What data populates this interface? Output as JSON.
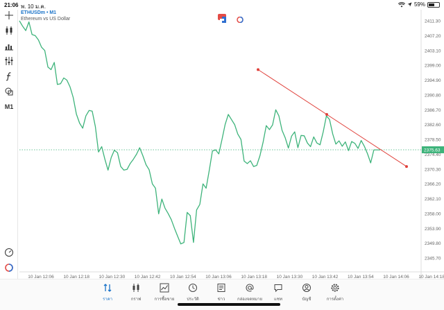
{
  "status": {
    "time": "21:06",
    "date": "พ. 10 ม.ค.",
    "battery_pct": 0.59,
    "battery_label": "59%"
  },
  "symbol": {
    "name": "ETHUSDm • M1",
    "description": "Ethereum vs US Dollar"
  },
  "toolbar": {
    "timeframe_label": "M1",
    "tools": [
      "crosshair-icon",
      "candle-icon",
      "bar-chart-icon",
      "settings-sliders-icon",
      "function-icon",
      "shapes-icon"
    ]
  },
  "chart_data": {
    "type": "line",
    "color": "#3db37a",
    "y_axis_labels": [
      "2411.30",
      "2407.20",
      "2403.10",
      "2399.00",
      "2394.90",
      "2390.80",
      "2386.70",
      "2382.60",
      "2378.50",
      "2374.40",
      "2370.30",
      "2366.20",
      "2362.10",
      "2358.00",
      "2353.90",
      "2349.80",
      "2345.70"
    ],
    "x_axis_labels": [
      "10 Jan 12:06",
      "10 Jan 12:18",
      "10 Jan 12:30",
      "10 Jan 12:42",
      "10 Jan 12:54",
      "10 Jan 13:06",
      "10 Jan 13:18",
      "10 Jan 13:30",
      "10 Jan 13:42",
      "10 Jan 13:54",
      "10 Jan 14:06",
      "10 Jan 14:18"
    ],
    "current_price_label": "2375.63",
    "current_price": 2375.63,
    "ylim": [
      2345.7,
      2411.3
    ],
    "series": [
      {
        "values": [
          2411.3,
          2409.8,
          2408.6,
          2411.0,
          2407.5,
          2407.2,
          2406.0,
          2404.0,
          2403.1,
          2398.5,
          2397.8,
          2399.8,
          2393.7,
          2393.9,
          2395.5,
          2394.9,
          2393.0,
          2390.1,
          2385.5,
          2383.0,
          2381.6,
          2385.0,
          2386.5,
          2386.3,
          2382.0,
          2375.0,
          2376.5,
          2373.0,
          2370.0,
          2373.5,
          2375.5,
          2374.8,
          2371.0,
          2370.0,
          2370.2,
          2371.8,
          2373.0,
          2374.4,
          2376.2,
          2374.0,
          2371.5,
          2370.1,
          2366.2,
          2365.0,
          2357.9,
          2362.0,
          2359.5,
          2358.0,
          2356.3,
          2353.9,
          2351.7,
          2349.6,
          2350.0,
          2358.3,
          2357.4,
          2350.0,
          2359.0,
          2360.5,
          2366.2,
          2365.0,
          2370.0,
          2375.3,
          2375.6,
          2374.5,
          2378.4,
          2382.6,
          2385.4,
          2384.0,
          2382.6,
          2380.0,
          2378.5,
          2372.5,
          2371.8,
          2372.6,
          2371.0,
          2371.3,
          2374.0,
          2377.7,
          2382.3,
          2381.2,
          2382.5,
          2386.7,
          2385.0,
          2381.0,
          2378.9,
          2376.1,
          2379.4,
          2380.6,
          2376.2,
          2379.6,
          2379.5,
          2377.5,
          2376.5,
          2379.2,
          2377.5,
          2377.0,
          2380.6,
          2385.0,
          2384.0,
          2380.0,
          2377.2,
          2378.1,
          2376.6,
          2377.8,
          2375.4,
          2377.9,
          2377.4,
          2376.0,
          2378.2,
          2376.6,
          2374.5,
          2372.0,
          2375.6,
          2375.6,
          2375.6
        ]
      }
    ],
    "trend_line": {
      "color": "#e0413b",
      "from_value": 2397.8,
      "to_value": 2371.0
    }
  },
  "tabs": [
    {
      "label": "ราคา",
      "icon": "updown-arrows-icon",
      "active": true
    },
    {
      "label": "กราฟ",
      "icon": "candle-icon",
      "active": false
    },
    {
      "label": "การซื้อขาย",
      "icon": "trend-chart-icon",
      "active": false
    },
    {
      "label": "ประวัติ",
      "icon": "history-icon",
      "active": false
    },
    {
      "label": "ข่าว",
      "icon": "news-icon",
      "active": false
    },
    {
      "label": "กล่องจดหมาย",
      "icon": "at-icon",
      "active": false
    },
    {
      "label": "แชท",
      "icon": "chat-icon",
      "active": false
    },
    {
      "label": "บัญชี",
      "icon": "account-icon",
      "active": false
    },
    {
      "label": "การตั้งค่า",
      "icon": "gear-icon",
      "active": false
    }
  ]
}
